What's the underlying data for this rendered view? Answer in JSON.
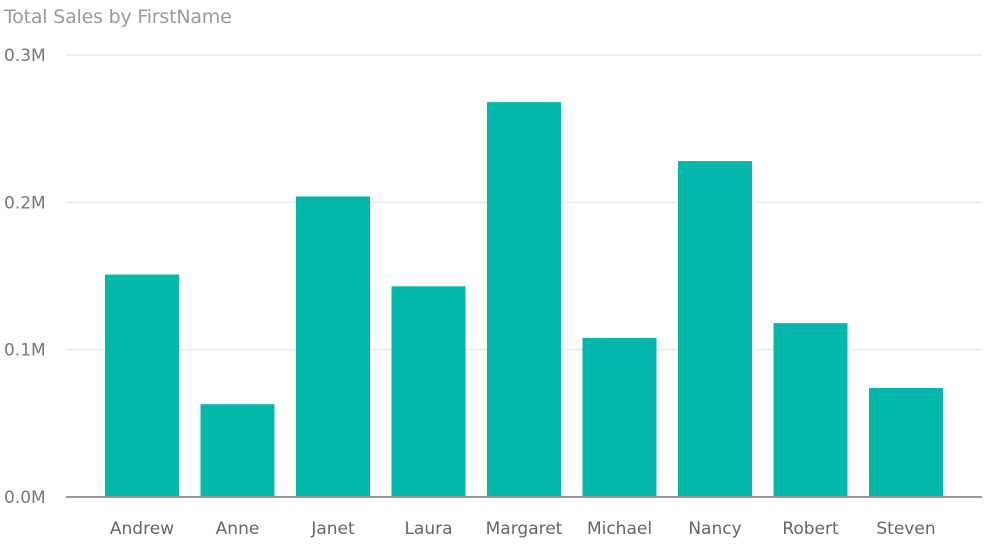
{
  "chart_data": {
    "type": "bar",
    "title": "Total Sales by FirstName",
    "xlabel": "",
    "ylabel": "",
    "categories": [
      "Andrew",
      "Anne",
      "Janet",
      "Laura",
      "Margaret",
      "Michael",
      "Nancy",
      "Robert",
      "Steven"
    ],
    "series": [
      {
        "name": "Total Sales",
        "values": [
          151000,
          63000,
          204000,
          143000,
          268000,
          108000,
          228000,
          118000,
          74000
        ]
      }
    ],
    "ylim": [
      0,
      300000
    ],
    "yticks": [
      0,
      100000,
      200000,
      300000
    ],
    "ytick_labels": [
      "0.0M",
      "0.1M",
      "0.2M",
      "0.3M"
    ],
    "grid": true,
    "legend": "none",
    "colors": {
      "bar": "#01B8AA",
      "grid": "#eeeeee",
      "axis": "#999999"
    }
  }
}
